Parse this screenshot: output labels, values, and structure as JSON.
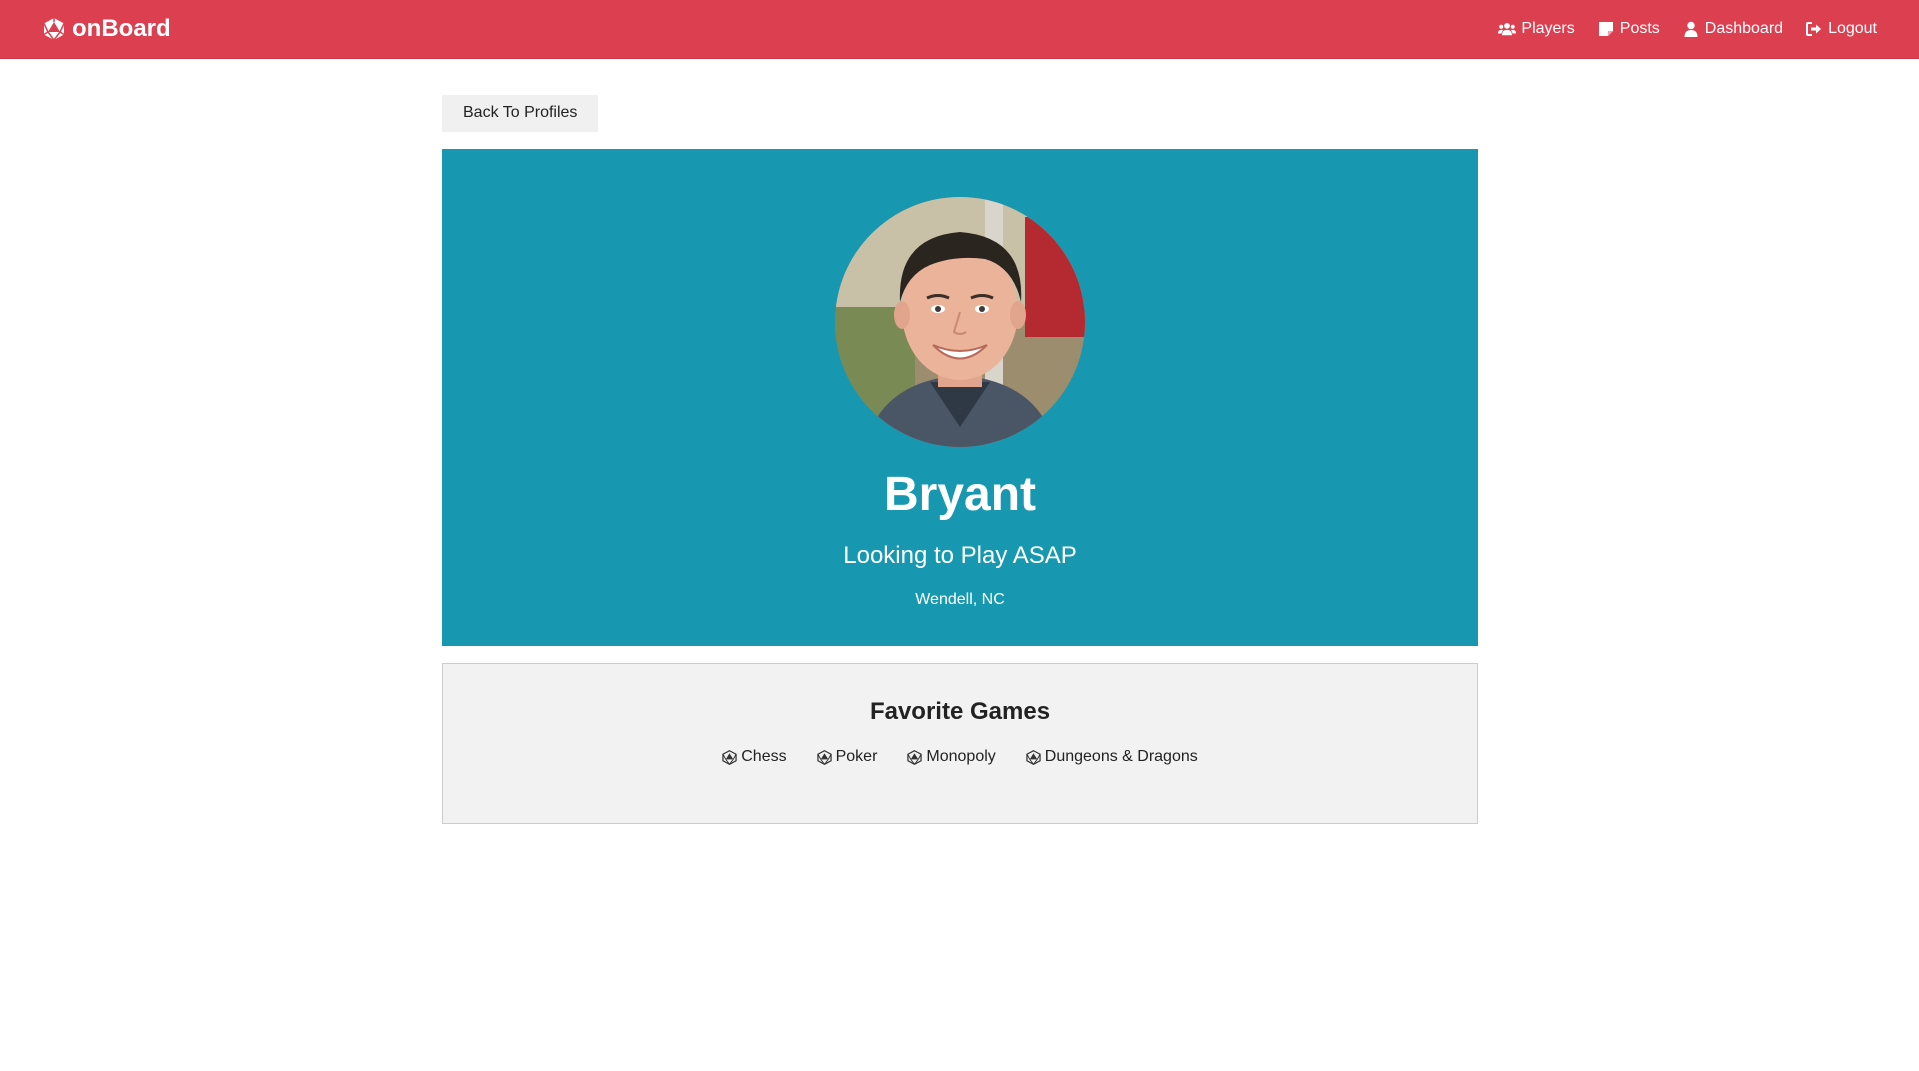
{
  "brand": {
    "name": "onBoard",
    "icon": "d20-dice-icon"
  },
  "nav": {
    "items": [
      {
        "label": "Players",
        "icon": "users-icon"
      },
      {
        "label": "Posts",
        "icon": "sticky-note-icon"
      },
      {
        "label": "Dashboard",
        "icon": "user-icon"
      },
      {
        "label": "Logout",
        "icon": "sign-out-icon"
      }
    ]
  },
  "back_button": {
    "label": "Back To Profiles"
  },
  "profile": {
    "name": "Bryant",
    "status": "Looking to Play ASAP",
    "location": "Wendell, NC"
  },
  "favorite_games": {
    "title": "Favorite Games",
    "games": [
      {
        "label": "Chess",
        "icon": "d20-dice-icon"
      },
      {
        "label": "Poker",
        "icon": "d20-dice-icon"
      },
      {
        "label": "Monopoly",
        "icon": "d20-dice-icon"
      },
      {
        "label": "Dungeons & Dragons",
        "icon": "d20-dice-icon"
      }
    ]
  },
  "colors": {
    "navbar": "#dc3f4f",
    "profile_card": "#1798b0",
    "games_card": "#f2f2f2",
    "back_button": "#f0f0f0"
  }
}
